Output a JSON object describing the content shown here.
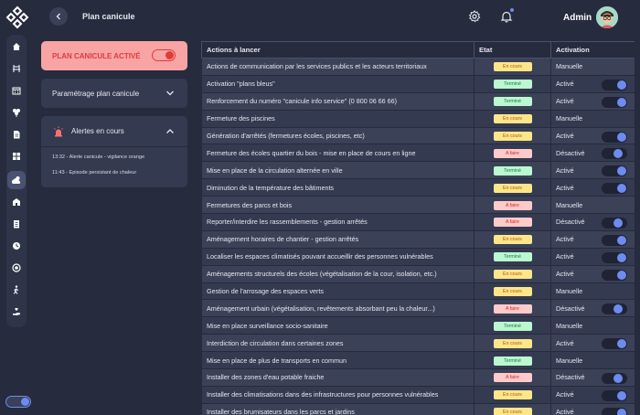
{
  "header": {
    "title": "Plan canicule",
    "user_name": "Admin"
  },
  "colors": {
    "background": "#262b3d",
    "accent": "#6c8cf0",
    "danger": "#e03b3b",
    "plan_card": "#f9a4a4"
  },
  "sidebar": {
    "icons": [
      "home-icon",
      "chair-icon",
      "calendar-icon",
      "flower-icon",
      "document-icon",
      "grid-icon",
      "cloud-sun-icon",
      "house-icon",
      "file-icon",
      "clock-icon",
      "shield-icon",
      "person-walking-icon",
      "hand-heart-icon"
    ],
    "active": "cloud-sun-icon"
  },
  "plan": {
    "label": "PLAN CANICULE ACTIVÉ",
    "active": true
  },
  "params": {
    "label": "Paramétrage plan canicule"
  },
  "alerts": {
    "label": "Alertes en cours",
    "items": [
      "13:32 - Alerte canicule - vigilance orange",
      "11:43 - Episode persistant de chaleur"
    ]
  },
  "table": {
    "headers": [
      "Actions à lancer",
      "Etat",
      "Activation"
    ],
    "rows": [
      {
        "action": "Actions de communication par les services publics et les acteurs territoriaux",
        "state": "En cours",
        "activation": "Manuelle",
        "switch": "none"
      },
      {
        "action": "Activation \"plans bleus\"",
        "state": "Terminé",
        "activation": "Activé",
        "switch": "on"
      },
      {
        "action": "Renforcement du numéro \"canicule info service\" (0 800 06 66 66)",
        "state": "Terminé",
        "activation": "Activé",
        "switch": "on"
      },
      {
        "action": "Fermeture des piscines",
        "state": "En cours",
        "activation": "Manuelle",
        "switch": "none"
      },
      {
        "action": "Génération d'arrêtés (fermetures écoles, piscines, etc)",
        "state": "En cours",
        "activation": "Activé",
        "switch": "on"
      },
      {
        "action": "Fermeture des écoles quartier du bois - mise en place de cours en ligne",
        "state": "A faire",
        "activation": "Désactivé",
        "switch": "off"
      },
      {
        "action": "Mise en place de la circulation alternée en ville",
        "state": "Terminé",
        "activation": "Activé",
        "switch": "on"
      },
      {
        "action": "Diminution de la température des bâtiments",
        "state": "En cours",
        "activation": "Activé",
        "switch": "on"
      },
      {
        "action": "Fermetures des parcs et bois",
        "state": "A faire",
        "activation": "Manuelle",
        "switch": "none"
      },
      {
        "action": "Reporter/interdire les rassemblements - gestion arrêtés",
        "state": "A faire",
        "activation": "Désactivé",
        "switch": "off"
      },
      {
        "action": "Aménagement horaires de chantier - gestion arrêtés",
        "state": "En cours",
        "activation": "Activé",
        "switch": "on"
      },
      {
        "action": "Localiser les espaces climatisés pouvant accueillir des personnes vulnérables",
        "state": "Terminé",
        "activation": "Activé",
        "switch": "on"
      },
      {
        "action": "Aménagements structurels des écoles (végétalisation de la cour, isolation, etc.)",
        "state": "En cours",
        "activation": "Activé",
        "switch": "on"
      },
      {
        "action": "Gestion de l'arrosage des espaces verts",
        "state": "En cours",
        "activation": "Manuelle",
        "switch": "none"
      },
      {
        "action": "Aménagement urbain (végétalisation, revêtements absorbant peu la chaleur...)",
        "state": "A faire",
        "activation": "Désactivé",
        "switch": "off"
      },
      {
        "action": "Mise en place surveillance socio-sanitaire",
        "state": "Terminé",
        "activation": "Manuelle",
        "switch": "none"
      },
      {
        "action": "Interdiction de circulation dans certaines zones",
        "state": "En cours",
        "activation": "Activé",
        "switch": "on"
      },
      {
        "action": "Mise en place de plus de transports en commun",
        "state": "Terminé",
        "activation": "Manuelle",
        "switch": "none"
      },
      {
        "action": "Installer des zones d'eau potable fraiche",
        "state": "A faire",
        "activation": "Désactivé",
        "switch": "off"
      },
      {
        "action": "Installer des climatisations dans des infrastructures pour personnes vulnérables",
        "state": "En cours",
        "activation": "Activé",
        "switch": "on"
      },
      {
        "action": "Installer des brumisateurs dans les parcs et jardins",
        "state": "En cours",
        "activation": "Activé",
        "switch": "on"
      }
    ]
  }
}
